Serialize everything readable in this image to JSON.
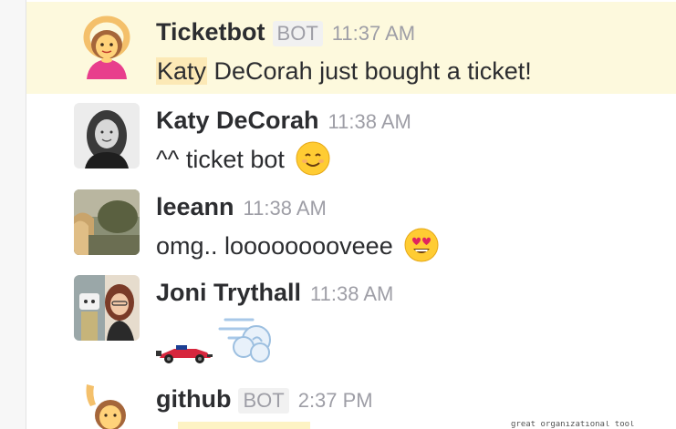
{
  "messages": [
    {
      "author": "Ticketbot",
      "bot_tag": "BOT",
      "time": "11:37 AM",
      "mention": "Katy",
      "text": " DeCorah just bought a ticket!"
    },
    {
      "author": "Katy DeCorah",
      "time": "11:38 AM",
      "text": "^^ ticket bot",
      "emoji": "smiling-face-emoji"
    },
    {
      "author": "leeann",
      "time": "11:38 AM",
      "text": "omg.. looooooooveee",
      "emoji": "heart-eyes-emoji"
    },
    {
      "author": "Joni Trythall",
      "time": "11:38 AM",
      "emoji_1": "race-car-emoji",
      "emoji_2": "dash-emoji"
    },
    {
      "author": "github",
      "bot_tag": "BOT",
      "time": "2:37 PM"
    }
  ],
  "footer_snippet": "great organizational tool"
}
